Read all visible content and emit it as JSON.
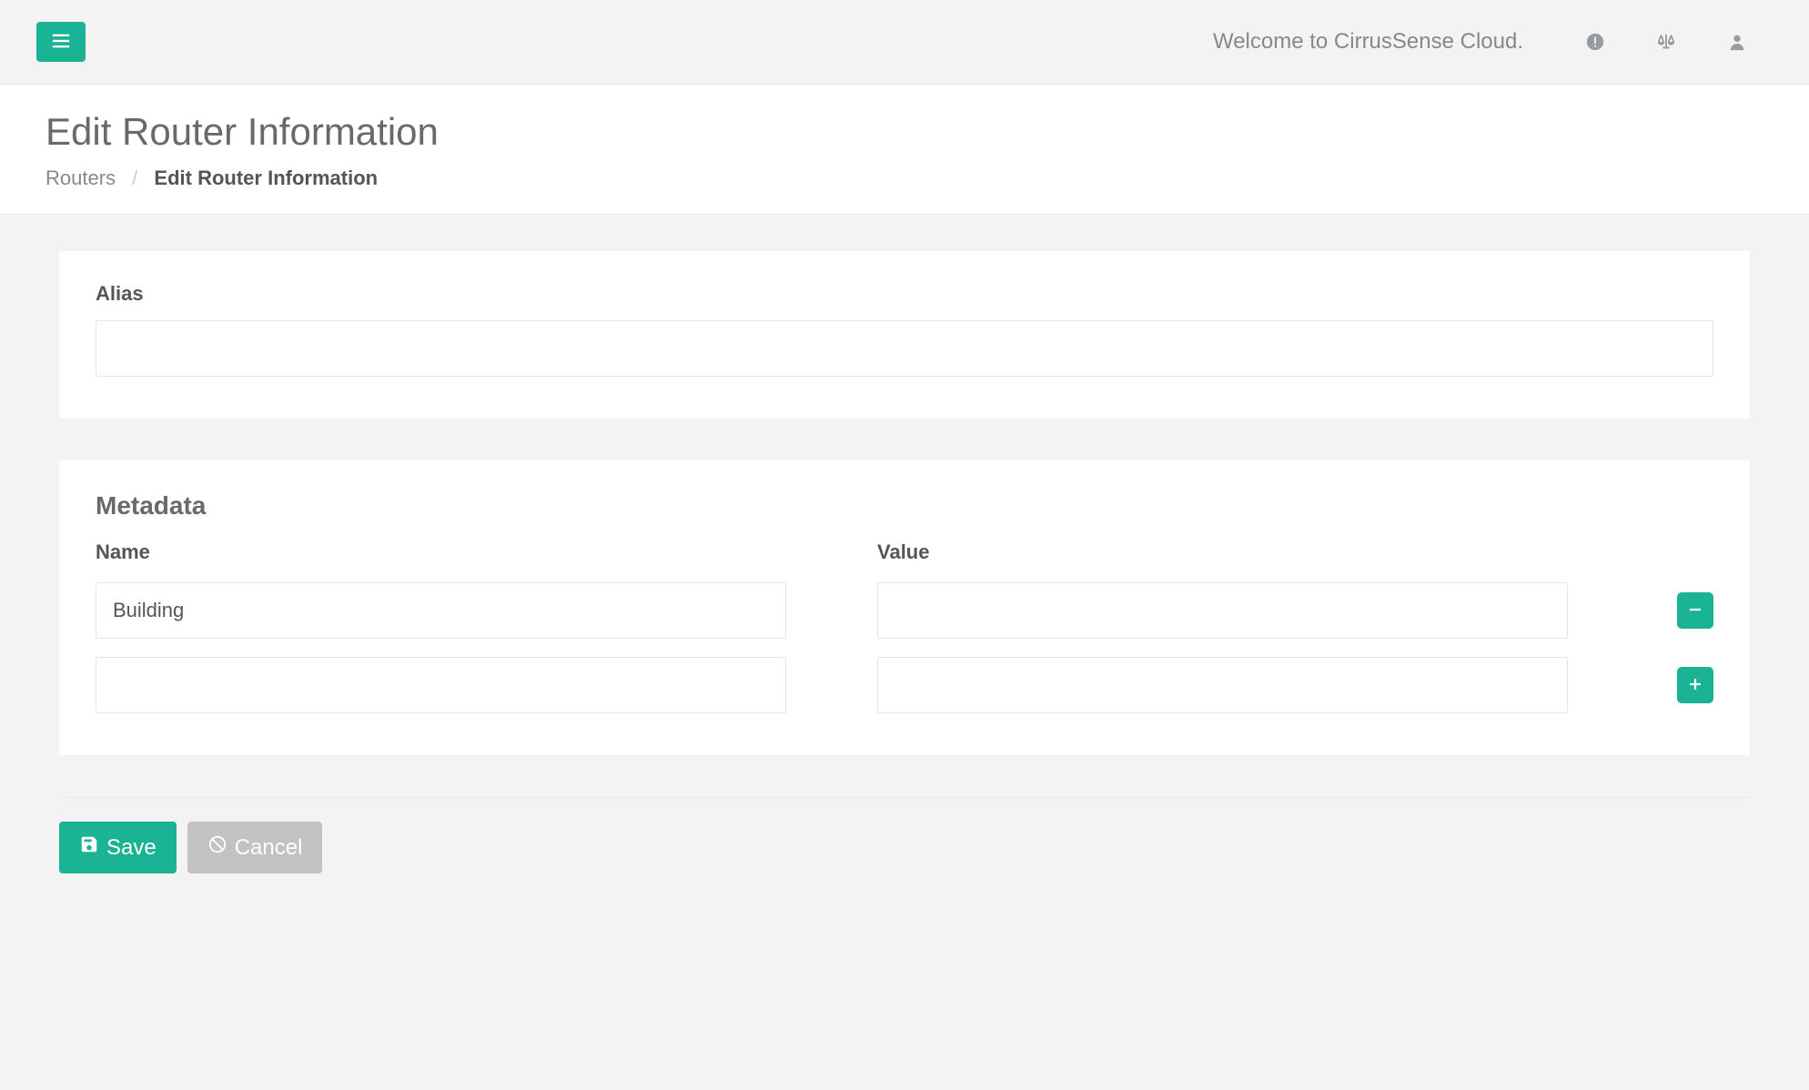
{
  "topbar": {
    "welcome_text": "Welcome to CirrusSense Cloud."
  },
  "page": {
    "title": "Edit Router Information",
    "breadcrumb": {
      "parent": "Routers",
      "current": "Edit Router Information"
    }
  },
  "form": {
    "alias": {
      "label": "Alias",
      "value": ""
    },
    "metadata": {
      "title": "Metadata",
      "col_name": "Name",
      "col_value": "Value",
      "rows": [
        {
          "name": "Building",
          "value": ""
        },
        {
          "name": "",
          "value": ""
        }
      ]
    },
    "actions": {
      "save_label": "Save",
      "cancel_label": "Cancel"
    }
  },
  "colors": {
    "accent": "#1ab394",
    "muted": "#c2c2c2"
  }
}
